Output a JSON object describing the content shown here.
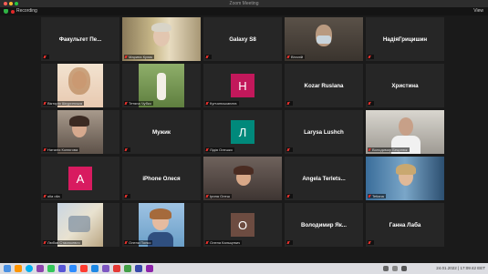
{
  "window": {
    "title": "Zoom Meeting"
  },
  "topbar": {
    "recording_label": "Recording",
    "view_label": "View"
  },
  "colors": {
    "active_speaker": "#23d959",
    "mute": "#e5322d",
    "tile_bg": "#262626"
  },
  "participants": [
    {
      "name": "Факультет Пе...",
      "label": ""
    },
    {
      "name": "",
      "label": "Марина Кулик"
    },
    {
      "name": "Galaxy S8",
      "label": ""
    },
    {
      "name": "",
      "label": "Віталій"
    },
    {
      "name": "НадіяГрицишин",
      "label": ""
    },
    {
      "name": "",
      "label": "Вікторія Шкуринська"
    },
    {
      "name": "",
      "label": "Тетяна Чубко"
    },
    {
      "name": "",
      "label": "Купчинськаната",
      "avatar_letter": "H",
      "avatar_color": "#c2185b"
    },
    {
      "name": "Kozar Ruslana",
      "label": ""
    },
    {
      "name": "Христина",
      "label": ""
    },
    {
      "name": "",
      "label": "Наталія Конюгова"
    },
    {
      "name": "Мужик",
      "label": ""
    },
    {
      "name": "",
      "label": "Лідія Олешко",
      "avatar_letter": "Л",
      "avatar_color": "#00897b"
    },
    {
      "name": "Larysa Lushch",
      "label": ""
    },
    {
      "name": "",
      "label": "Володимир Бецинюк",
      "active": true
    },
    {
      "name": "",
      "label": "olia olia",
      "avatar_letter": "A",
      "avatar_color": "#d81b60"
    },
    {
      "name": "iPhone Олеся",
      "label": ""
    },
    {
      "name": "",
      "label": "Ірина Олеш"
    },
    {
      "name": "Angela Terlets...",
      "label": ""
    },
    {
      "name": "",
      "label": "Tetiana"
    },
    {
      "name": "",
      "label": "Любов Стасюкевич"
    },
    {
      "name": "",
      "label": "Олена Попко"
    },
    {
      "name": "",
      "label": "Олена Кальцевич",
      "avatar_letter": "O",
      "avatar_color": "#6d4c41"
    },
    {
      "name": "Володимир Як...",
      "label": ""
    },
    {
      "name": "Ганна Лаба",
      "label": ""
    }
  ],
  "dock": {
    "time": "24.01.2022 | 17:09:42 EET"
  }
}
